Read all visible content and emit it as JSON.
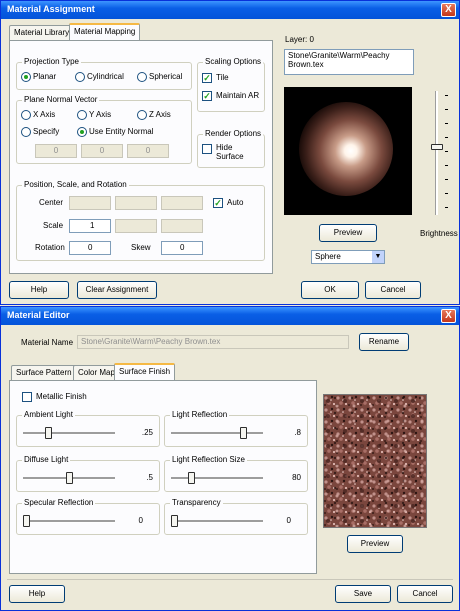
{
  "assignment": {
    "title": "Material Assignment",
    "close": "X",
    "tabs": [
      "Material Library",
      "Material Mapping"
    ],
    "layer_label": "Layer: 0",
    "material_path": "Stone\\Granite\\Warm\\Peachy Brown.tex",
    "projection": {
      "title": "Projection Type",
      "options": [
        "Planar",
        "Cylindrical",
        "Spherical"
      ],
      "selected": "Planar"
    },
    "plane_normal": {
      "title": "Plane Normal Vector",
      "options": [
        "X Axis",
        "Y Axis",
        "Z Axis"
      ],
      "specify": "Specify",
      "use_entity": "Use Entity Normal",
      "selected": "Use Entity Normal",
      "values": [
        "0",
        "0",
        "0"
      ]
    },
    "scaling": {
      "title": "Scaling Options",
      "tile": "Tile",
      "tile_checked": true,
      "maintain_ar": "Maintain AR",
      "maintain_ar_checked": true
    },
    "render": {
      "title": "Render Options",
      "hide_surface": "Hide Surface",
      "hide_surface_checked": false
    },
    "position": {
      "title": "Position, Scale, and Rotation",
      "center_label": "Center",
      "scale_label": "Scale",
      "scale_value": "1",
      "rotation_label": "Rotation",
      "rotation_value": "0",
      "skew_label": "Skew",
      "skew_value": "0",
      "auto_label": "Auto",
      "auto_checked": true
    },
    "preview_button": "Preview",
    "brightness_label": "Brightness",
    "brightness_level": 0.45,
    "shape_select": "Sphere",
    "buttons": {
      "help": "Help",
      "clear": "Clear Assignment",
      "ok": "OK",
      "cancel": "Cancel"
    }
  },
  "editor": {
    "title": "Material Editor",
    "close": "X",
    "material_name_label": "Material Name",
    "material_name_value": "Stone\\Granite\\Warm\\Peachy Brown.tex",
    "rename": "Rename",
    "tabs": [
      "Surface Pattern",
      "Color Map",
      "Surface Finish"
    ],
    "metallic_finish": "Metallic Finish",
    "metallic_checked": false,
    "sliders": [
      {
        "label": "Ambient Light",
        "value": ".25",
        "level": 0.25
      },
      {
        "label": "Light Reflection",
        "value": ".8",
        "level": 0.8
      },
      {
        "label": "Diffuse Light",
        "value": ".5",
        "level": 0.5
      },
      {
        "label": "Light Reflection Size",
        "value": "80",
        "level": 0.2
      },
      {
        "label": "Specular Reflection",
        "value": "0",
        "level": 0.0
      },
      {
        "label": "Transparency",
        "value": "0",
        "level": 0.0
      }
    ],
    "preview_button": "Preview",
    "buttons": {
      "help": "Help",
      "save": "Save",
      "cancel": "Cancel"
    }
  }
}
